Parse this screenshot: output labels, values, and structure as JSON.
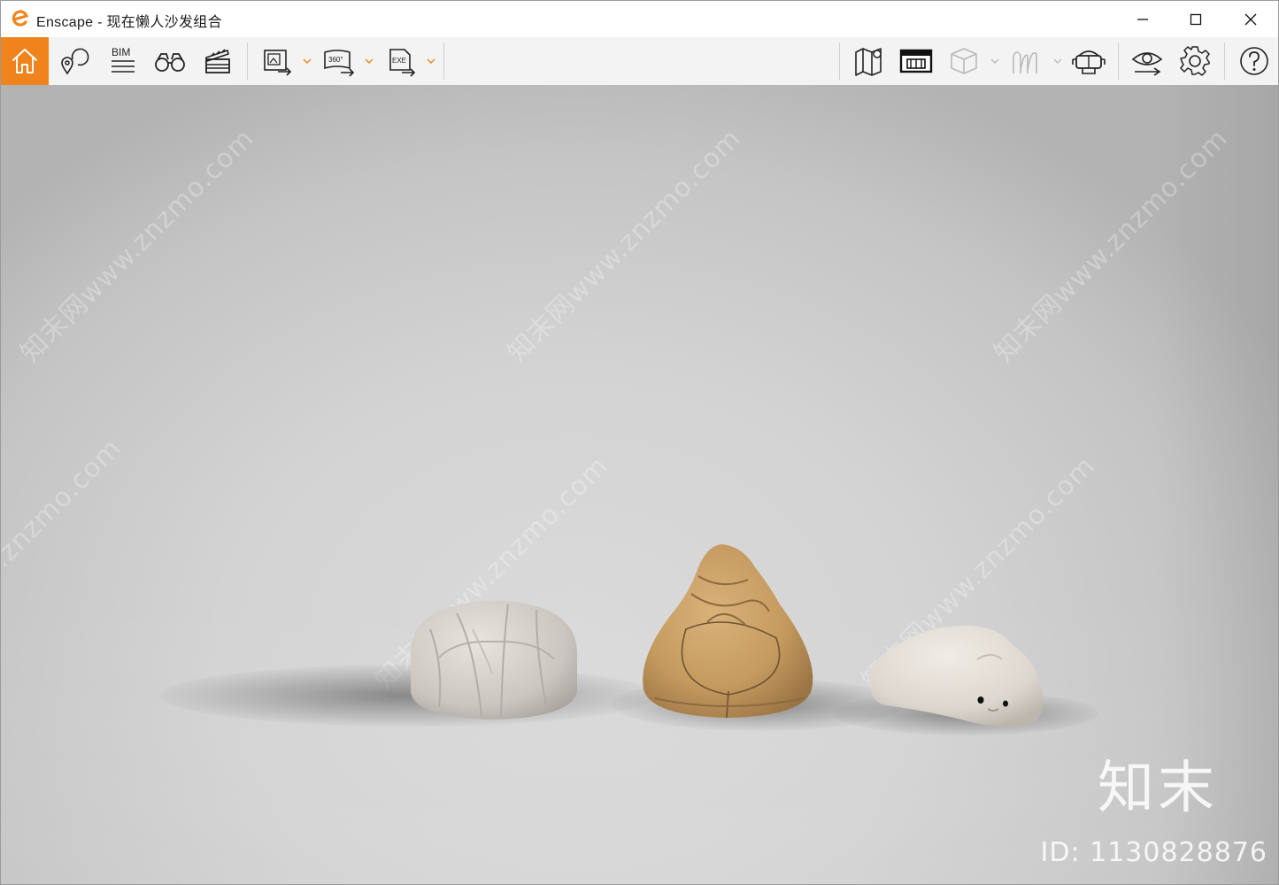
{
  "window": {
    "title": "Enscape - 现在懒人沙发组合",
    "accent_color": "#f0841c"
  },
  "window_controls": [
    {
      "name": "minimize",
      "icon": "minimize-icon"
    },
    {
      "name": "maximize",
      "icon": "maximize-icon"
    },
    {
      "name": "close",
      "icon": "close-icon"
    }
  ],
  "toolbar": {
    "left": [
      {
        "name": "home",
        "icon": "home-icon",
        "active": true
      },
      {
        "name": "views",
        "icon": "location-pins-icon"
      },
      {
        "name": "bim",
        "icon": "bim-icon",
        "label": "BIM"
      },
      {
        "name": "binoculars",
        "icon": "binoculars-icon"
      },
      {
        "name": "video-editor",
        "icon": "clapperboard-icon"
      },
      {
        "name": "render-image",
        "icon": "image-export-icon"
      },
      {
        "name": "panorama",
        "icon": "panorama-export-icon",
        "label": "360°"
      },
      {
        "name": "exe-export",
        "icon": "exe-export-icon",
        "label": "EXE"
      }
    ],
    "right": [
      {
        "name": "map",
        "icon": "map-icon"
      },
      {
        "name": "asset-library",
        "icon": "asset-library-icon"
      },
      {
        "name": "cube",
        "icon": "cube-icon"
      },
      {
        "name": "atmosphere",
        "icon": "atmosphere-icon"
      },
      {
        "name": "vr-headset",
        "icon": "vr-headset-icon"
      },
      {
        "name": "visual-settings",
        "icon": "eye-icon"
      },
      {
        "name": "settings",
        "icon": "gear-icon"
      },
      {
        "name": "help",
        "icon": "help-icon"
      }
    ]
  },
  "viewport": {
    "scene": "three lazy sofas on a seamless grey studio backdrop",
    "items": [
      "pumpkin-armchair",
      "beanbag-chair",
      "polar-bear-pouf"
    ],
    "watermark_text": "知末网www.znzmo.com",
    "logo_text": "知末",
    "id_text": "ID: 1130828876"
  }
}
